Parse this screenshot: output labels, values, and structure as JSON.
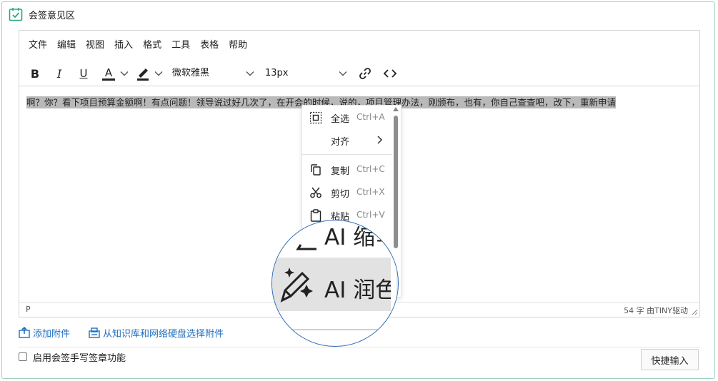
{
  "header": {
    "title": "会签意见区",
    "icon": "calendar-check-icon",
    "accent": "#2aa87a"
  },
  "menubar": {
    "items": [
      "文件",
      "编辑",
      "视图",
      "插入",
      "格式",
      "工具",
      "表格",
      "帮助"
    ]
  },
  "toolbar": {
    "bold": "B",
    "italic": "I",
    "underline": "U",
    "text_color": "A",
    "font_family": "微软雅黑",
    "font_size": "13px",
    "icons": [
      "bold-icon",
      "italic-icon",
      "underline-icon",
      "text-color-icon",
      "highlight-color-icon",
      "link-icon",
      "source-code-icon"
    ]
  },
  "content": {
    "text": "啊？你？看下项目预算金额啊！有点问题！领导说过好几次了，在开会的时候，说的，项目管理办法，刚颁布，也有，你自己查查吧，改下，重新申请"
  },
  "context_menu": {
    "items": [
      {
        "label": "全选",
        "shortcut": "Ctrl+A",
        "icon": "select-all-icon"
      },
      {
        "label": "对齐",
        "shortcut": "",
        "icon": ""
      },
      {
        "label": "复制",
        "shortcut": "Ctrl+C",
        "icon": "copy-icon"
      },
      {
        "label": "剪切",
        "shortcut": "Ctrl+X",
        "icon": "cut-icon"
      },
      {
        "label": "粘贴",
        "shortcut": "Ctrl+V",
        "icon": "paste-icon"
      }
    ]
  },
  "magnifier": {
    "item1": "AI 缩写",
    "item2": "AI 润色",
    "item1_icon": "ai-shorten-icon",
    "item2_icon": "ai-polish-icon"
  },
  "statusbar": {
    "path": "P",
    "word_count": "54 字  由TINY驱动"
  },
  "attachments": {
    "add": "添加附件",
    "from_kb": "从知识库和网络硬盘选择附件",
    "link_color": "#1e6fc0"
  },
  "signature_toggle": {
    "label": "启用会签手写签章功能",
    "checked": false
  },
  "quick_input": {
    "label": "快捷输入"
  }
}
